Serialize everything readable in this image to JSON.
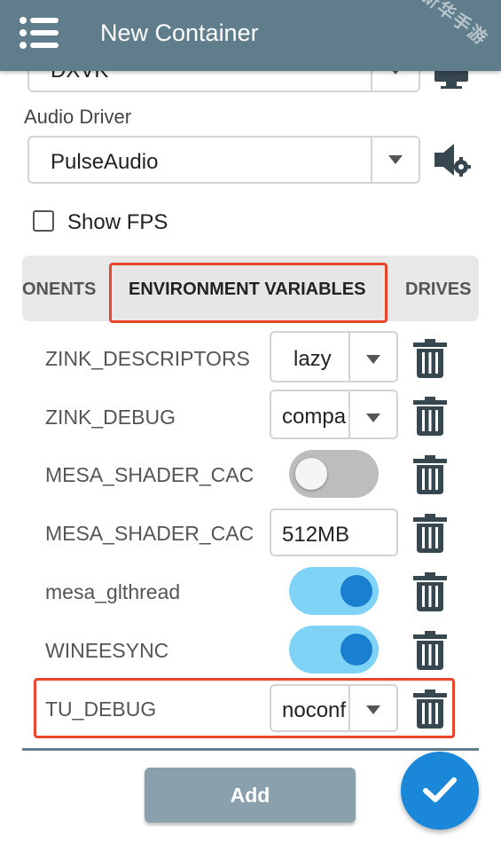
{
  "app_bar": {
    "title": "New Container",
    "menu_icon": "menu-list-icon",
    "background": "#5f7d8b",
    "watermark": "新华手游"
  },
  "dxvk_select": {
    "value": "DXVK"
  },
  "audio_driver": {
    "label": "Audio Driver",
    "value": "PulseAudio",
    "settings_icon": "speaker-gear-icon"
  },
  "display_icon": "monitor-settings-icon",
  "show_fps": {
    "label": "Show FPS",
    "checked": false
  },
  "tabs": {
    "left": "ONENTS",
    "active": "ENVIRONMENT VARIABLES",
    "right": "DRIVES"
  },
  "env_vars": [
    {
      "name": "ZINK_DESCRIPTORS",
      "type": "select",
      "value": "lazy"
    },
    {
      "name": "ZINK_DEBUG",
      "type": "select",
      "value": "compa"
    },
    {
      "name": "MESA_SHADER_CAC",
      "type": "toggle",
      "on": false
    },
    {
      "name": "MESA_SHADER_CAC",
      "type": "input",
      "value": "512MB"
    },
    {
      "name": "mesa_glthread",
      "type": "toggle",
      "on": true
    },
    {
      "name": "WINEESYNC",
      "type": "toggle",
      "on": true
    },
    {
      "name": "TU_DEBUG",
      "type": "select",
      "value": "noconf"
    }
  ],
  "add_button": {
    "label": "Add"
  },
  "fab": {
    "icon": "check-icon",
    "color": "#1a87d9"
  },
  "highlight_color": "#e8452b"
}
